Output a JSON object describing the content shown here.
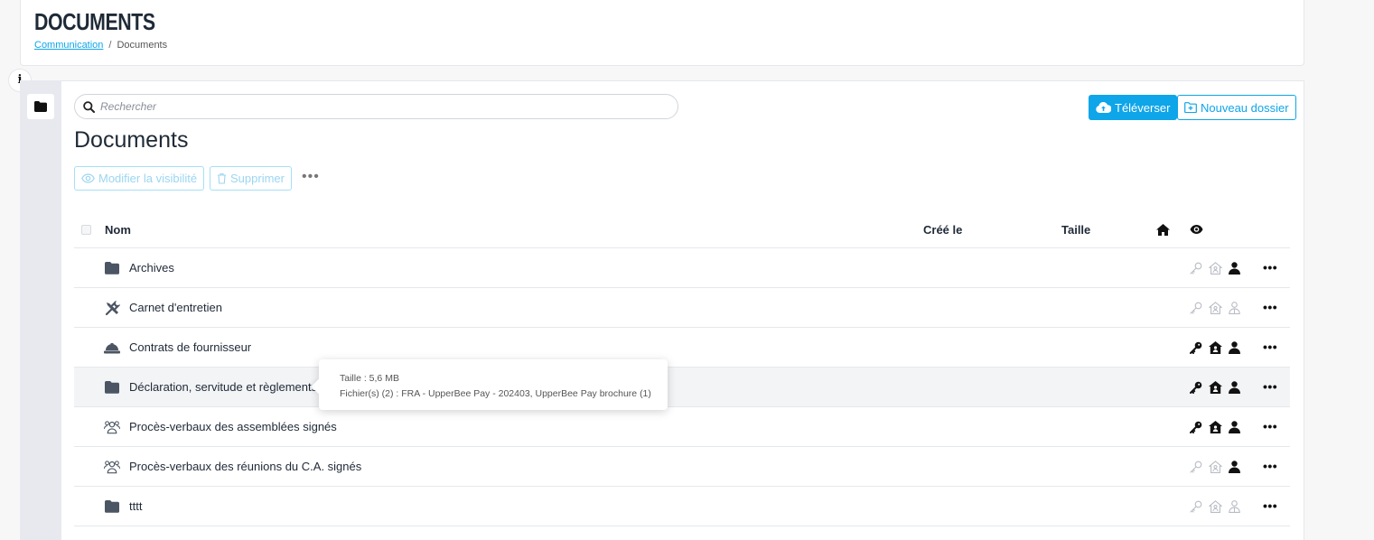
{
  "header": {
    "title": "DOCUMENTS",
    "breadcrumb": {
      "link": "Communication",
      "separator": "/",
      "current": "Documents"
    }
  },
  "info_button": "i",
  "toolbar": {
    "search_placeholder": "Rechercher",
    "upload_label": "Téléverser",
    "new_folder_label": "Nouveau dossier"
  },
  "section_title": "Documents",
  "actions": {
    "visibility_label": "Modifier la visibilité",
    "delete_label": "Supprimer",
    "more_label": "•••"
  },
  "table": {
    "headers": {
      "name": "Nom",
      "created": "Créé le",
      "size": "Taille"
    },
    "more_label": "•••",
    "rows": [
      {
        "name": "Archives",
        "icon": "folder-icon",
        "perms": [
          "off",
          "off",
          "on"
        ]
      },
      {
        "name": "Carnet d'entretien",
        "icon": "tools-icon",
        "perms": [
          "off",
          "off",
          "off"
        ]
      },
      {
        "name": "Contrats de fournisseur",
        "icon": "hardhat-icon",
        "perms": [
          "on",
          "on",
          "on"
        ]
      },
      {
        "name": "Déclaration, servitude et règlements",
        "icon": "folder-icon",
        "perms": [
          "on",
          "on",
          "on"
        ]
      },
      {
        "name": "Procès-verbaux des assemblées signés",
        "icon": "people-icon",
        "perms": [
          "on",
          "on",
          "on"
        ]
      },
      {
        "name": "Procès-verbaux des réunions du C.A. signés",
        "icon": "people-icon",
        "perms": [
          "off",
          "off",
          "on"
        ]
      },
      {
        "name": "tttt",
        "icon": "folder-icon",
        "perms": [
          "off",
          "off",
          "off"
        ]
      }
    ]
  },
  "tooltip": {
    "size_line": "Taille : 5,6 MB",
    "files_line": "Fichier(s) (2) : FRA - UpperBee Pay - 202403, UpperBee Pay brochure (1)"
  },
  "colors": {
    "accent": "#0ea5e9",
    "text_dark": "#1f2937",
    "perm_on": "#111111",
    "perm_off": "#b8bcc4"
  }
}
